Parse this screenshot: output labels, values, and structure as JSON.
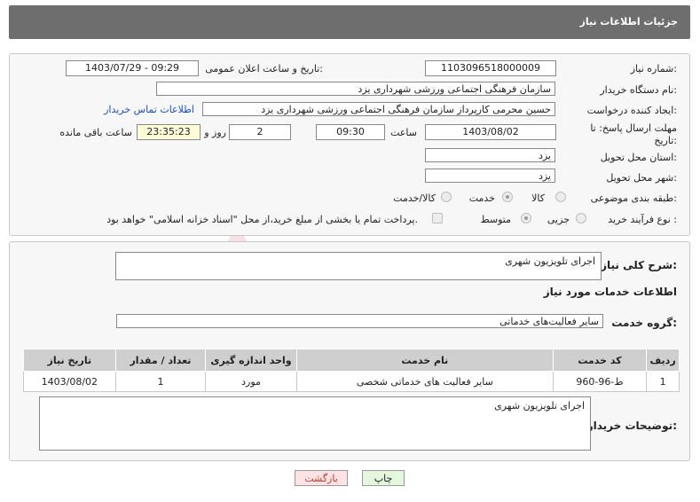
{
  "header": {
    "title": "جزئیات اطلاعات نیاز"
  },
  "form": {
    "need_number_label": "شماره نیاز:",
    "need_number": "1103096518000009",
    "announce_label": "تاریخ و ساعت اعلان عمومی:",
    "announce_value": "1403/07/29 - 09:29",
    "buyer_org_label": "نام دستگاه خریدار:",
    "buyer_org": "سازمان فرهنگی اجتماعی ورزشی شهرداری یزد",
    "creator_label": "ایجاد کننده درخواست:",
    "creator": "حسین محرمی کارپرداز سازمان فرهنگی اجتماعی ورزشی شهرداری یزد",
    "contact_link": "اطلاعات تماس خریدار",
    "deadline_label": "مهلت ارسال پاسخ: تا تاریخ:",
    "deadline_date": "1403/08/02",
    "time_label": "ساعت",
    "deadline_time": "09:30",
    "days_value": "2",
    "days_label": "روز و",
    "remaining_time": "23:35:23",
    "remaining_label": "ساعت باقی مانده",
    "province_label": "استان محل تحویل:",
    "province": "یزد",
    "city_label": "شهر محل تحویل:",
    "city": "یزد",
    "category_label": "طبقه بندی موضوعی:",
    "category_options": [
      "کالا",
      "خدمت",
      "کالا/خدمت"
    ],
    "category_selected": "خدمت",
    "process_label": "نوع فرآیند خرید :",
    "process_options": [
      "جزیی",
      "متوسط"
    ],
    "process_selected": "متوسط",
    "payment_note": "پرداخت تمام یا بخشی از مبلغ خرید،از محل \"اسناد خزانه اسلامی\" خواهد بود."
  },
  "summary": {
    "label": "شرح کلی نیاز:",
    "value": "اجرای تلویزیون شهری"
  },
  "services": {
    "section_title": "اطلاعات خدمات مورد نیاز",
    "group_label": "گروه خدمت:",
    "group_value": "سایر فعالیت‌های خدماتی",
    "columns": [
      "ردیف",
      "کد خدمت",
      "نام خدمت",
      "واحد اندازه گیری",
      "تعداد / مقدار",
      "تاریخ نیاز"
    ],
    "rows": [
      [
        "1",
        "ط-96-960",
        "سایر فعالیت های خدماتی شخصی",
        "مورد",
        "1",
        "1403/08/02"
      ]
    ]
  },
  "buyer_notes": {
    "label": "توضیحات خریدار:",
    "value": "اجرای تلویزیون شهری"
  },
  "buttons": {
    "print": "چاپ",
    "back": "بازگشت"
  },
  "watermark": "AriaTender.net",
  "colors": {
    "header_bg": "#6e6e6e",
    "print_btn": "#e4f6dc",
    "back_btn": "#fbe3e6",
    "watermark": "#c1272d"
  }
}
